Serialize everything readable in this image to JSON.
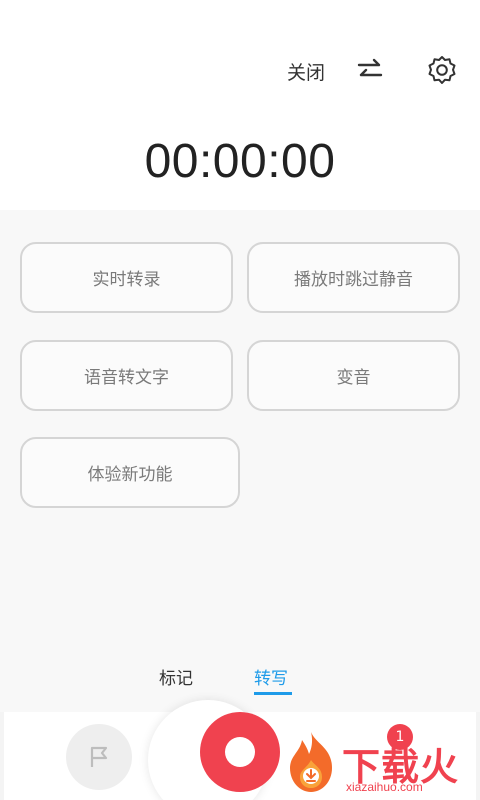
{
  "header": {
    "close_label": "关闭",
    "swap_icon": "swap-icon",
    "settings_icon": "gear-icon"
  },
  "timer": {
    "value": "00:00:00"
  },
  "options": [
    {
      "label": "实时转录"
    },
    {
      "label": "播放时跳过静音"
    },
    {
      "label": "语音转文字"
    },
    {
      "label": "变音"
    },
    {
      "label": "体验新功能"
    }
  ],
  "tabs": {
    "mark_label": "标记",
    "transcribe_label": "转写",
    "active": "转写"
  },
  "bottom_bar": {
    "flag_icon": "flag-icon",
    "record_icon": "record-icon",
    "badge_count": "1"
  },
  "watermark": {
    "logo_text": "下载火",
    "url": "xiazaihuo.com"
  },
  "colors": {
    "accent_blue": "#1e9be9",
    "record_red": "#f0424f"
  }
}
